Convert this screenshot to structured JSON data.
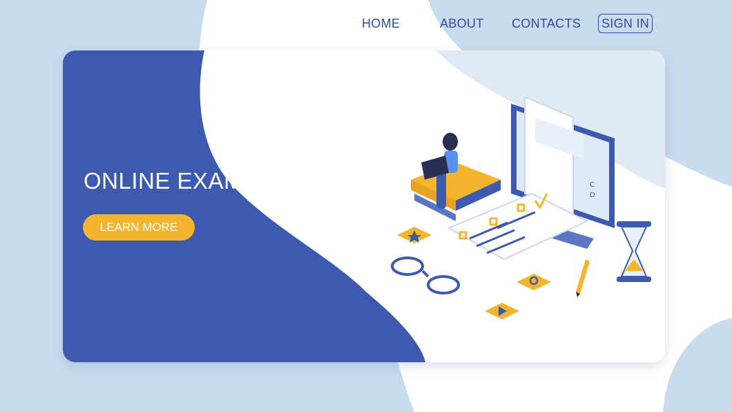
{
  "nav": {
    "home": "HOME",
    "about": "ABOUT",
    "contacts": "CONTACTS",
    "sign_in": "SIGN IN"
  },
  "hero": {
    "title": "ONLINE EXAM",
    "cta_label": "LEARN MORE"
  },
  "illustration": {
    "answer_letters": [
      "C",
      "D"
    ]
  },
  "colors": {
    "page_background": "#c9dcee",
    "card_blue": "#3d5aaf",
    "nav_text": "#2f4a9e",
    "accent_yellow": "#f3b52c",
    "white": "#ffffff"
  }
}
